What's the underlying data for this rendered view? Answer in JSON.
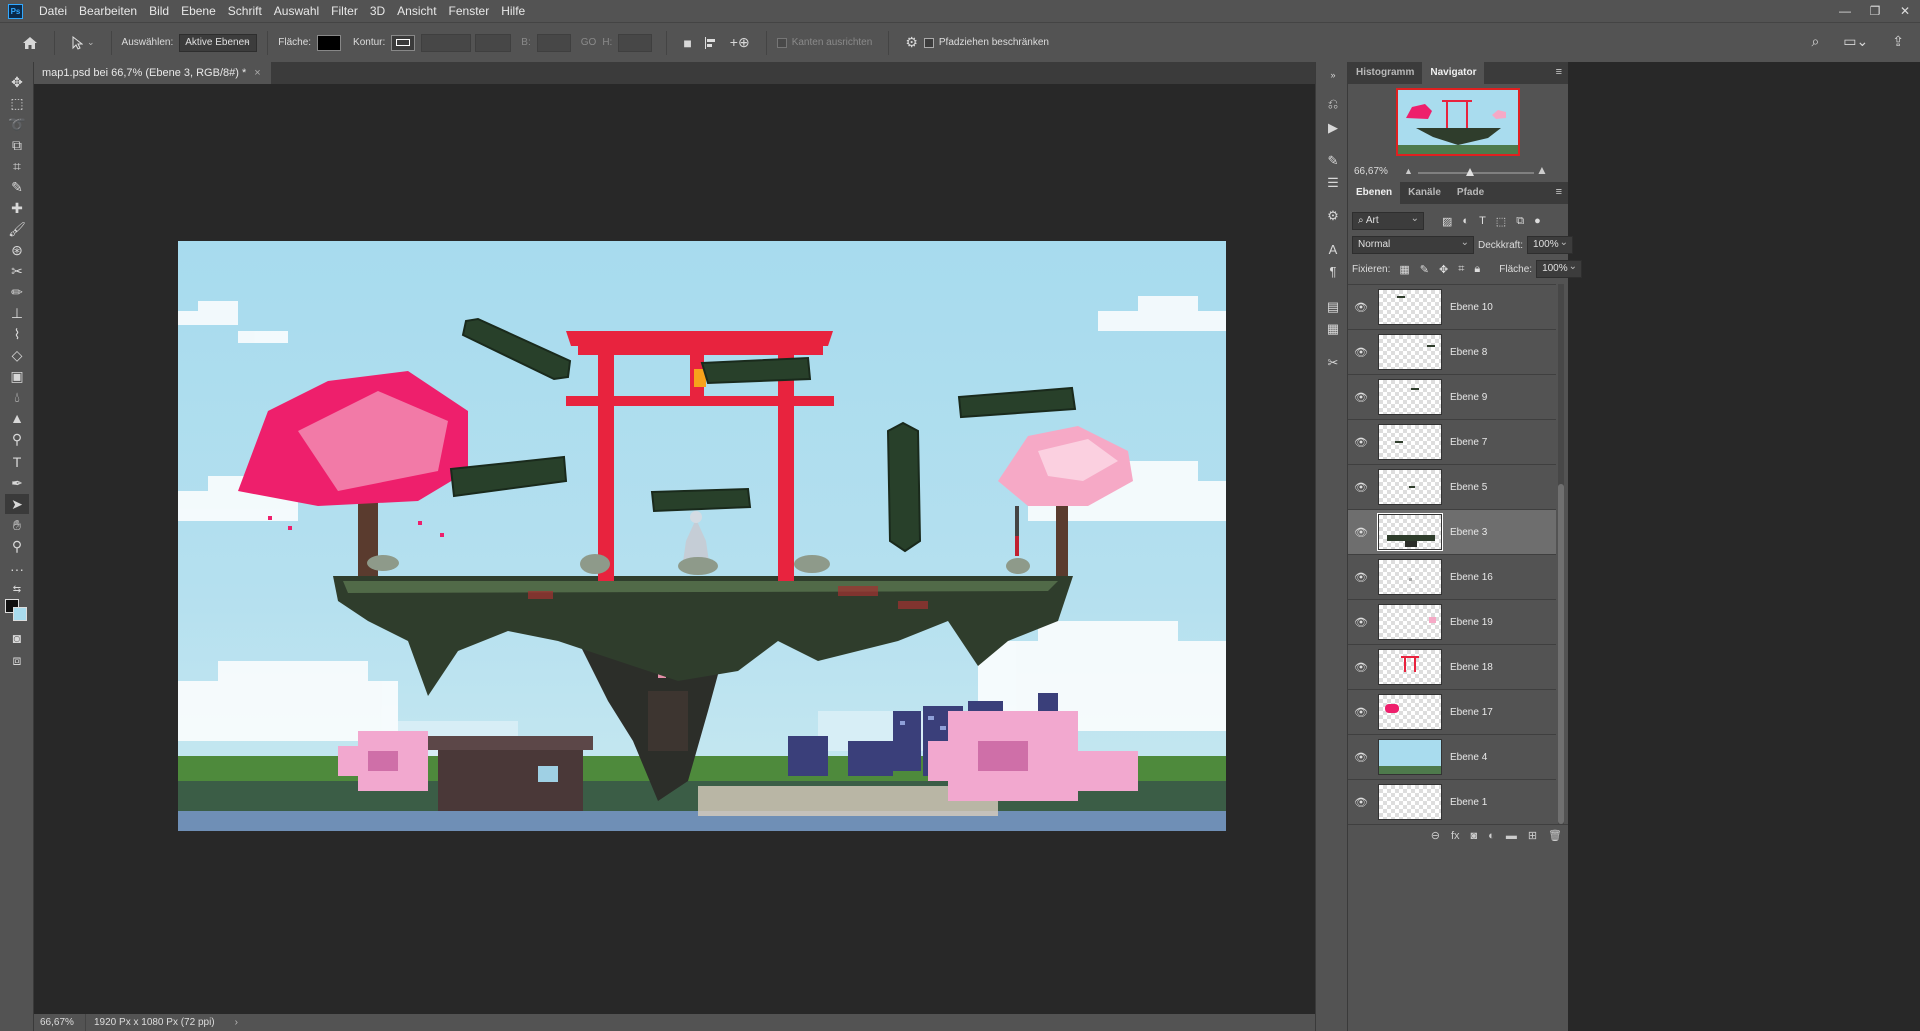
{
  "app": {
    "logo": "Ps",
    "menu": [
      "Datei",
      "Bearbeiten",
      "Bild",
      "Ebene",
      "Schrift",
      "Auswahl",
      "Filter",
      "3D",
      "Ansicht",
      "Fenster",
      "Hilfe"
    ],
    "window_controls": [
      "minimize-icon",
      "restore-icon",
      "close-icon"
    ]
  },
  "options": {
    "select_label": "Auswählen:",
    "select_value": "Aktive Ebenen",
    "fill_label": "Fläche:",
    "stroke_label": "Kontur:",
    "width_label": "B:",
    "height_label": "H:",
    "align_edges": "Kanten ausrichten",
    "constrain_path": "Pfadziehen beschränken"
  },
  "document": {
    "tab_title": "map1.psd bei 66,7% (Ebene 3, RGB/8#) *",
    "zoom": "66,67%",
    "info": "1920 Px x 1080 Px (72 ppi)"
  },
  "navigator": {
    "tabs": [
      "Histogramm",
      "Navigator"
    ],
    "active_tab": "Navigator",
    "zoom": "66,67%",
    "zoom_level_fraction": 0.45
  },
  "layers_panel": {
    "tabs": [
      "Ebenen",
      "Kanäle",
      "Pfade"
    ],
    "active_tab": "Ebenen",
    "filter": "Art",
    "blend_mode": "Normal",
    "opacity_label": "Deckkraft:",
    "opacity": "100%",
    "lock_label": "Fixieren:",
    "fill_label": "Fläche:",
    "fill": "100%",
    "layers": [
      {
        "name": "Ebene 10",
        "selected": false
      },
      {
        "name": "Ebene 8",
        "selected": false
      },
      {
        "name": "Ebene 9",
        "selected": false
      },
      {
        "name": "Ebene 7",
        "selected": false
      },
      {
        "name": "Ebene 5",
        "selected": false
      },
      {
        "name": "Ebene 3",
        "selected": true
      },
      {
        "name": "Ebene 16",
        "selected": false
      },
      {
        "name": "Ebene 19",
        "selected": false
      },
      {
        "name": "Ebene 18",
        "selected": false
      },
      {
        "name": "Ebene 17",
        "selected": false
      },
      {
        "name": "Ebene 4",
        "selected": false
      },
      {
        "name": "Ebene 1",
        "selected": false
      }
    ]
  },
  "colors": {
    "torii": "#e8233e",
    "sakura_dark": "#ee1f6c",
    "sakura_light": "#f6a9c6",
    "sky": "#a9dcee",
    "island": "#2f3d2c"
  }
}
